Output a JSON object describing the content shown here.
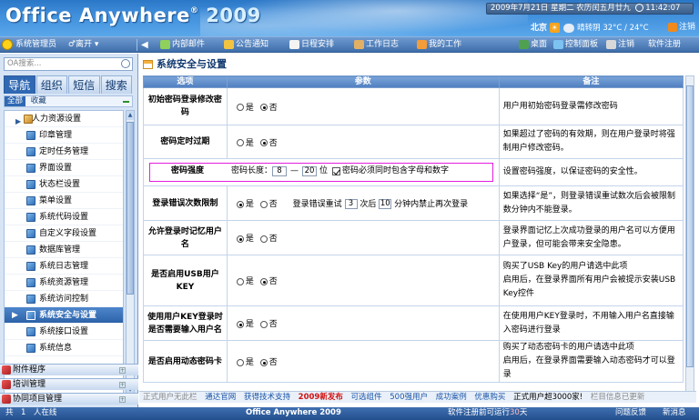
{
  "banner": {
    "logo": "Office Anywhere",
    "logo_reg": "®",
    "logo_year": "2009",
    "date": "2009年7月21日",
    "weekday": "星期二",
    "lunar": "农历闰五月廿九",
    "time": "11:42:07",
    "city": "北京",
    "weather": "晴转阴 32°C / 24°C",
    "logout": "注销"
  },
  "toolbar": {
    "user": "系统管理员",
    "status": "离开",
    "items": [
      "内部邮件",
      "公告通知",
      "日程安排",
      "工作日志",
      "我的工作"
    ],
    "right_items": [
      "桌面",
      "控制面板",
      "注销",
      "软件注册"
    ]
  },
  "sidebar": {
    "search_placeholder": "OA搜索...",
    "tabs": [
      "导航",
      "组织",
      "短信",
      "搜索"
    ],
    "subtabs": [
      "全部",
      "收藏"
    ],
    "items": [
      {
        "label": "人力资源设置",
        "group": true
      },
      {
        "label": "印章管理"
      },
      {
        "label": "定时任务管理"
      },
      {
        "label": "界面设置"
      },
      {
        "label": "状态栏设置"
      },
      {
        "label": "菜单设置"
      },
      {
        "label": "系统代码设置"
      },
      {
        "label": "自定义字段设置"
      },
      {
        "label": "数据库管理"
      },
      {
        "label": "系统日志管理"
      },
      {
        "label": "系统资源管理"
      },
      {
        "label": "系统访问控制"
      },
      {
        "label": "系统安全与设置",
        "active": true
      },
      {
        "label": "系统接口设置"
      },
      {
        "label": "系统信息"
      }
    ],
    "sections": [
      "附件程序",
      "培训管理",
      "协同项目管理"
    ]
  },
  "main": {
    "title": "系统安全与设置",
    "headers": [
      "选项",
      "参数",
      "备注"
    ],
    "rows": [
      {
        "label": "初始密码登录修改密码",
        "yes": "是",
        "no": "否",
        "yes_on": false,
        "note": "用户用初始密码登录需修改密码"
      },
      {
        "label": "密码定时过期",
        "yes": "是",
        "no": "否",
        "yes_on": false,
        "note": "如果超过了密码的有效期，则在用户登录时将强制用户修改密码。"
      },
      {
        "label": "密码强度",
        "len_label": "密码长度：",
        "min": "8",
        "dash": "—",
        "max": "20",
        "unit": "位",
        "check_label": "密码必须同时包含字母和数字",
        "note": "设置密码强度，以保证密码的安全性。"
      },
      {
        "label": "登录错误次数限制",
        "yes": "是",
        "no": "否",
        "yes_on": true,
        "p1": "登录错误重试",
        "tries": "3",
        "p2": "次后",
        "mins": "10",
        "p3": "分钟内禁止再次登录",
        "note": "如果选择“是”，则登录错误重试数次后会被限制数分钟内不能登录。"
      },
      {
        "label": "允许登录时记忆用户名",
        "yes": "是",
        "no": "否",
        "yes_on": true,
        "note": "登录界面记忆上次成功登录的用户名可以方便用户登录，但可能会带来安全隐患。"
      },
      {
        "label": "是否启用USB用户KEY",
        "yes": "是",
        "no": "否",
        "yes_on": false,
        "note1": "购买了USB Key的用户请选中此项",
        "note2": "启用后，在登录界面所有用户会被提示安装USB Key控件"
      },
      {
        "label": "使用用户KEY登录时是否需要输入用户名",
        "yes": "是",
        "no": "否",
        "yes_on": true,
        "note": "在使用用户KEY登录时，不用输入用户名直接输入密码进行登录"
      },
      {
        "label": "是否启用动态密码卡",
        "yes": "是",
        "no": "否",
        "yes_on": false,
        "note1": "购买了动态密码卡的用户请选中此项",
        "note2": "启用后，在登录界面需要输入动态密码才可以登录"
      }
    ]
  },
  "links": {
    "items": [
      {
        "text": "正式用户无此栏",
        "style": "gray"
      },
      {
        "text": "通达官网",
        "style": "blue"
      },
      {
        "text": "获得技术支持",
        "style": "blue"
      },
      {
        "text": "2009新发布",
        "style": "red"
      },
      {
        "text": "可选组件",
        "style": "blue"
      },
      {
        "text": "500强用户",
        "style": "blue"
      },
      {
        "text": "成功案例",
        "style": "blue"
      },
      {
        "text": "优惠购买",
        "style": "blue"
      },
      {
        "text": "正式用户超3000家!",
        "style": "plain"
      },
      {
        "text": "栏目信息已更新",
        "style": "gray"
      }
    ]
  },
  "status": {
    "online": "共　1　人在线",
    "product": "Office Anywhere 2009",
    "run_prefix": "软件注册前可运行",
    "run_days": "30",
    "run_suffix": "天",
    "feedback": "问题反馈",
    "messages": "新消息"
  },
  "colors": {
    "accent": "#2f68b3",
    "highlight_box": "#e21ee0",
    "link_red": "#d01010"
  }
}
